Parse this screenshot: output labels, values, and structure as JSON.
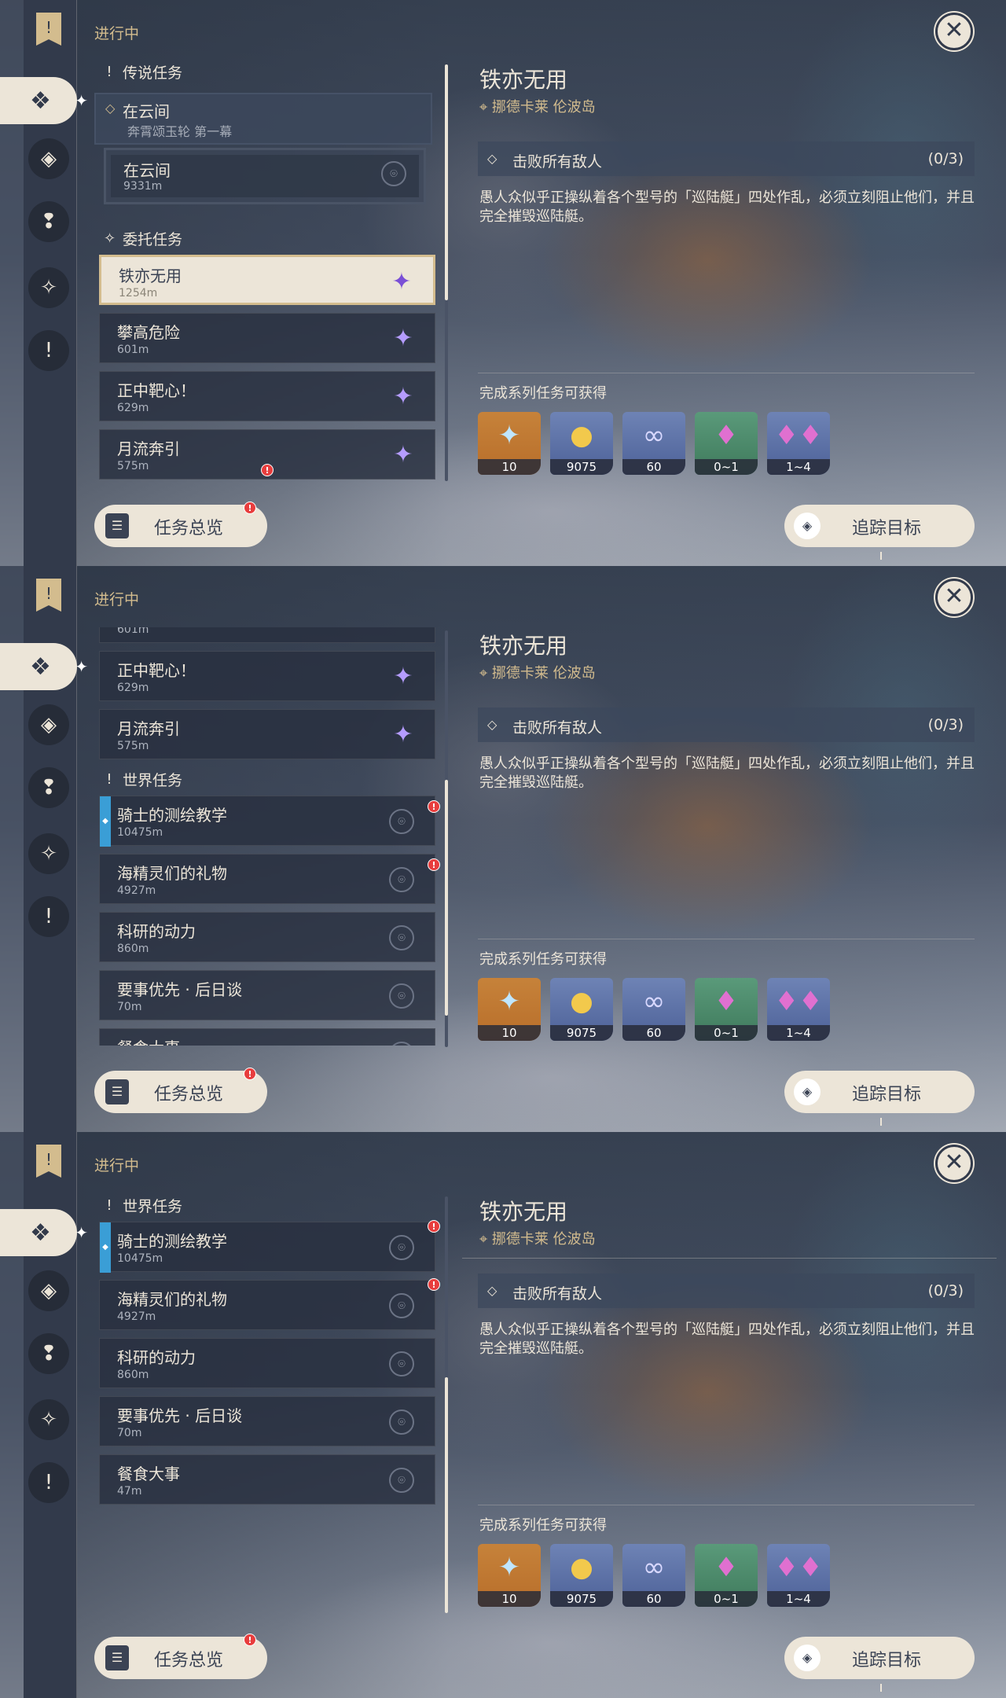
{
  "header": {
    "in_progress": "进行中",
    "close": "✕"
  },
  "quest_detail": {
    "title": "铁亦无用",
    "location": "挪德卡莱 伦波岛",
    "objective": "击败所有敌人",
    "objective_count": "(0/3)",
    "description": "愚人众似乎正操纵着各个型号的「巡陆艇」四处作乱，必须立刻阻止他们，并且完全摧毁巡陆艇。",
    "rewards_label": "完成系列任务可获得",
    "rewards": [
      {
        "icon": "primogem-icon",
        "count": "10"
      },
      {
        "icon": "mora-icon",
        "count": "9075"
      },
      {
        "icon": "adventure-exp-icon",
        "count": "60"
      },
      {
        "icon": "crystal-small-icon",
        "count": "0~1"
      },
      {
        "icon": "crystal-large-icon",
        "count": "1~4"
      }
    ]
  },
  "sections": {
    "legend": "传说任务",
    "commission": "委托任务",
    "world": "世界任务"
  },
  "legend_quest": {
    "name": "在云间",
    "desc": "奔霄颂玉轮 第一幕"
  },
  "legend_sub": {
    "name": "在云间",
    "dist": "9331m"
  },
  "commissions": [
    {
      "name": "铁亦无用",
      "dist": "1254m"
    },
    {
      "name": "攀高危险",
      "dist": "601m"
    },
    {
      "name": "正中靶心！",
      "dist": "629m"
    },
    {
      "name": "月流奔引",
      "dist": "575m"
    }
  ],
  "world_quests": [
    {
      "name": "骑士的测绘教学",
      "dist": "10475m"
    },
    {
      "name": "海精灵们的礼物",
      "dist": "4927m"
    },
    {
      "name": "科研的动力",
      "dist": "860m"
    },
    {
      "name": "要事优先 · 后日谈",
      "dist": "70m"
    },
    {
      "name": "餐食大事",
      "dist": "47m"
    }
  ],
  "buttons": {
    "overview": "任务总览",
    "track": "追踪目标"
  }
}
